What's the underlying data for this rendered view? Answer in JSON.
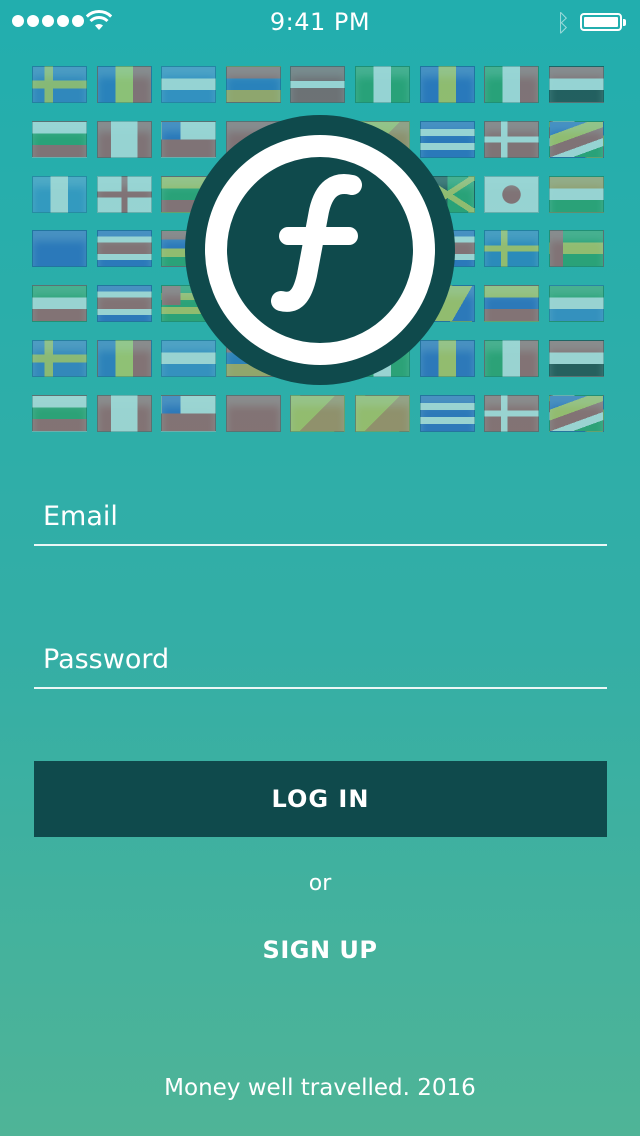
{
  "status_bar": {
    "time": "9:41 PM",
    "signal_icon": "signal-dots-icon",
    "wifi_icon": "wifi-icon",
    "bluetooth_icon": "bluetooth-icon",
    "battery_icon": "battery-icon",
    "battery_level": 1.0
  },
  "colors": {
    "accent": "#0f4a4c",
    "background_top": "#22aeae",
    "background_bottom": "#4fb497",
    "text": "#ffffff"
  },
  "logo": {
    "icon": "florin-logo-icon"
  },
  "flags": [
    [
      "aland",
      "moldova",
      "el-salvador",
      "armenia",
      "latvia",
      "nigeria",
      "barbados",
      "italy",
      "sudan"
    ],
    [
      "bulgaria",
      "canada",
      "chile",
      "china",
      "bhutan",
      "bhutan",
      "cuba",
      "denmark",
      "seychelles"
    ],
    [
      "guatemala",
      "georgia",
      "lithuania",
      "belarus",
      "sweden",
      "seychelles",
      "jamaica",
      "japan",
      "niger"
    ],
    [
      "australia",
      "costa-rica",
      "mauritius",
      "nigeria",
      "sweden",
      "costa-rica",
      "costa-rica",
      "sweden",
      "sao-tome"
    ],
    [
      "somaliland",
      "costa-rica",
      "togo",
      "lithuania",
      "cuba",
      "chile",
      "bosnia",
      "venezuela",
      "sierra-leone"
    ],
    [
      "aland",
      "moldova",
      "el-salvador",
      "armenia",
      "latvia",
      "nigeria",
      "barbados",
      "italy",
      "sudan"
    ],
    [
      "bulgaria",
      "canada",
      "chile",
      "china",
      "bhutan",
      "bhutan",
      "cuba",
      "denmark",
      "seychelles"
    ]
  ],
  "form": {
    "email_placeholder": "Email",
    "email_value": "",
    "password_placeholder": "Password",
    "password_value": "",
    "login_label": "LOG IN",
    "or_label": "or",
    "signup_label": "SIGN UP"
  },
  "footer": {
    "tagline": "Money well travelled. 2016"
  }
}
